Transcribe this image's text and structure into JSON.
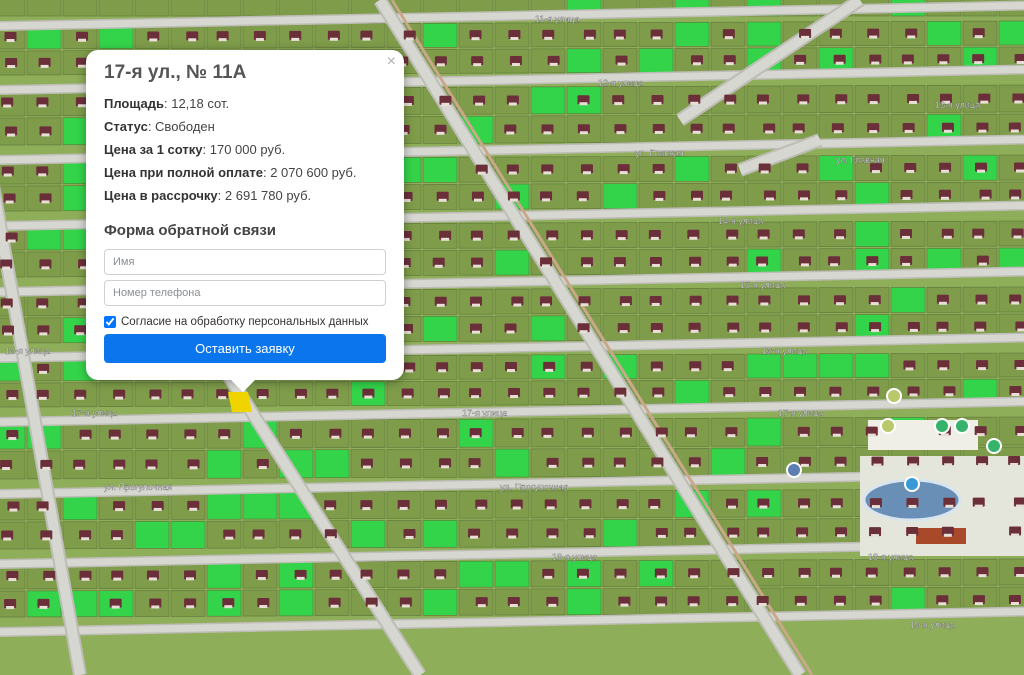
{
  "map": {
    "colors": {
      "grass": "#8fae5a",
      "road": "#d7d7d2",
      "road_edge": "#bdbdb5",
      "main_road": "#c9a88a",
      "plot_sold": "#7e9c4a",
      "plot_free": "#34d44a",
      "house_roof": "#6b2f3a",
      "water": "#6a8fb7",
      "selected_plot": "#f0d400"
    },
    "street_labels": [
      "11-я улица",
      "12-я улица",
      "13-я улица",
      "ул. Главная",
      "ул. Главная",
      "14-я улица",
      "15-я улица",
      "16-я улица",
      "16-я улица",
      "17-я улица",
      "17-я улица",
      "17-я улица",
      "ул. Прогулочная",
      "ул. Прогулочная",
      "18-я улица",
      "18-я улица",
      "19-я улица"
    ],
    "poi_icons": [
      "playground-icon",
      "shop-icon",
      "cafe-icon",
      "music-icon",
      "parking-icon",
      "water-drop-icon",
      "food-icon"
    ]
  },
  "popup": {
    "title": "17-я ул., № 11А",
    "close_glyph": "×",
    "rows": [
      {
        "label": "Площадь",
        "value": "12,18 сот."
      },
      {
        "label": "Статус",
        "value": "Свободен"
      },
      {
        "label": "Цена за 1 сотку",
        "value": "170 000 руб."
      },
      {
        "label": "Цена при полной оплате",
        "value": "2 070 600 руб."
      },
      {
        "label": "Цена в рассрочку",
        "value": "2 691 780 руб."
      }
    ],
    "form": {
      "title": "Форма обратной связи",
      "name_placeholder": "Имя",
      "phone_placeholder": "Номер телефона",
      "consent_label": "Согласие на обработку персональных данных",
      "consent_checked": true,
      "submit_label": "Оставить заявку"
    }
  }
}
